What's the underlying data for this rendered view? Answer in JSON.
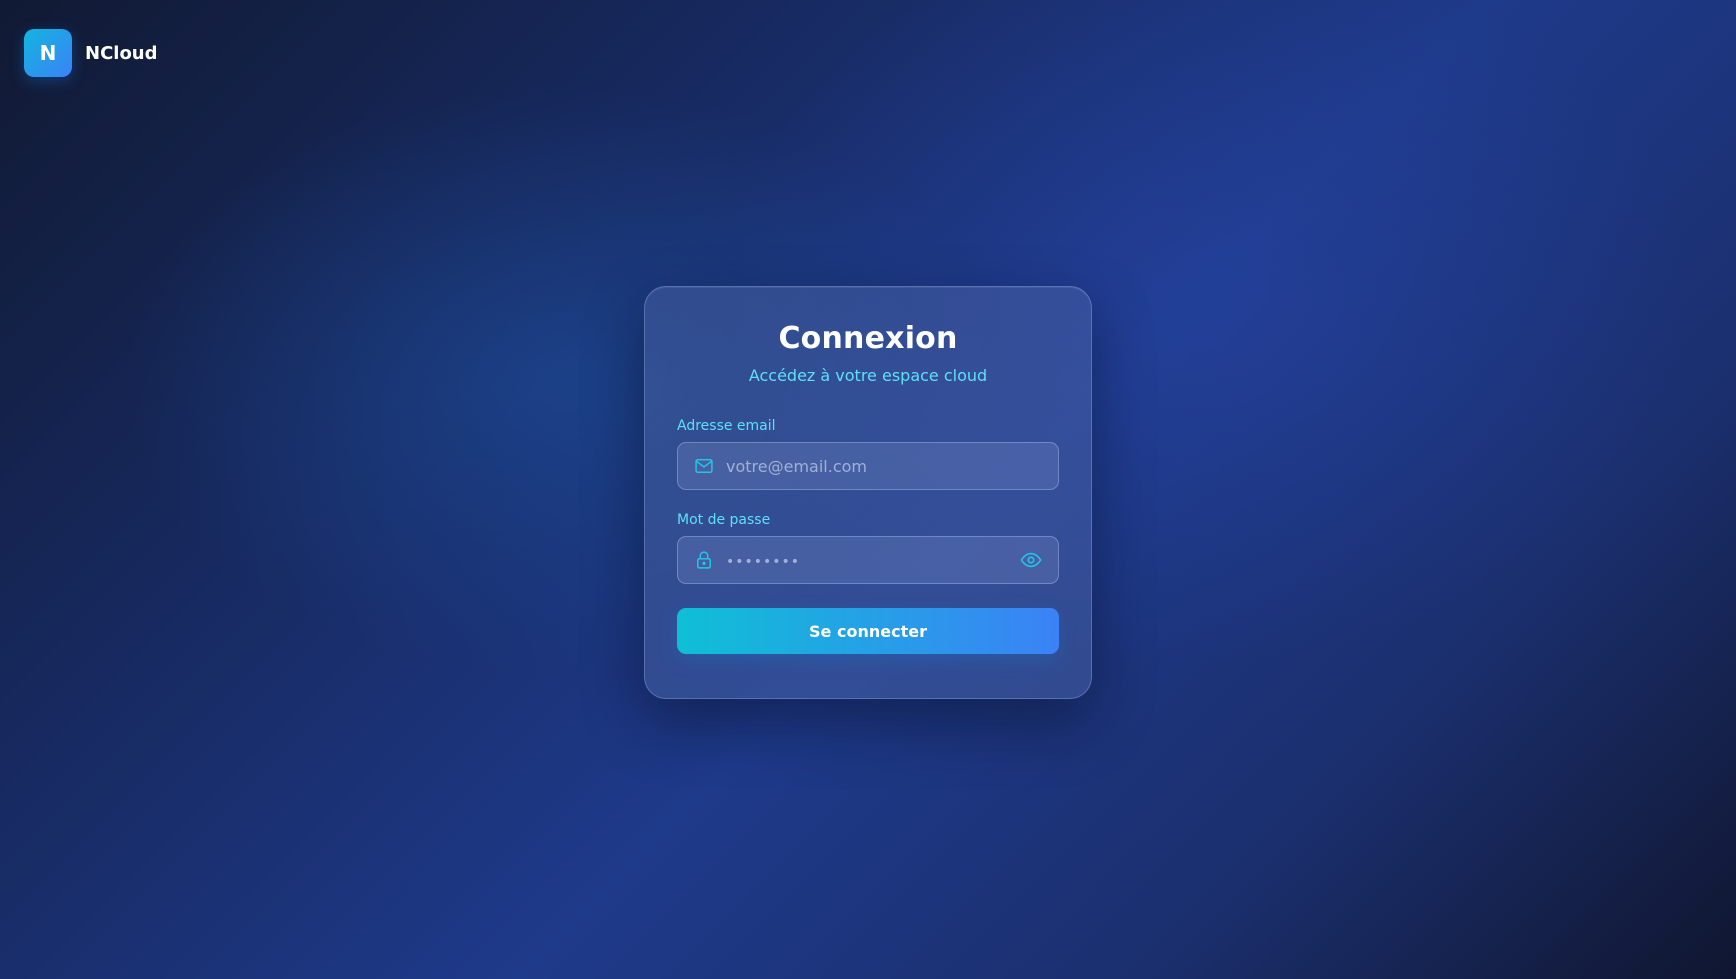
{
  "brand": {
    "logo_letter": "N",
    "name": "NCloud"
  },
  "login": {
    "title": "Connexion",
    "subtitle": "Accédez à votre espace cloud",
    "email": {
      "label": "Adresse email",
      "placeholder": "votre@email.com",
      "value": "",
      "icon": "mail-icon"
    },
    "password": {
      "label": "Mot de passe",
      "placeholder": "••••••••",
      "value": "",
      "icon": "lock-icon",
      "toggle_icon": "eye-icon"
    },
    "submit_label": "Se connecter"
  },
  "colors": {
    "accent": "#22d3ee",
    "button_start": "#0fbfd6",
    "button_end": "#3b82f6",
    "background": "#1e3a8a"
  }
}
